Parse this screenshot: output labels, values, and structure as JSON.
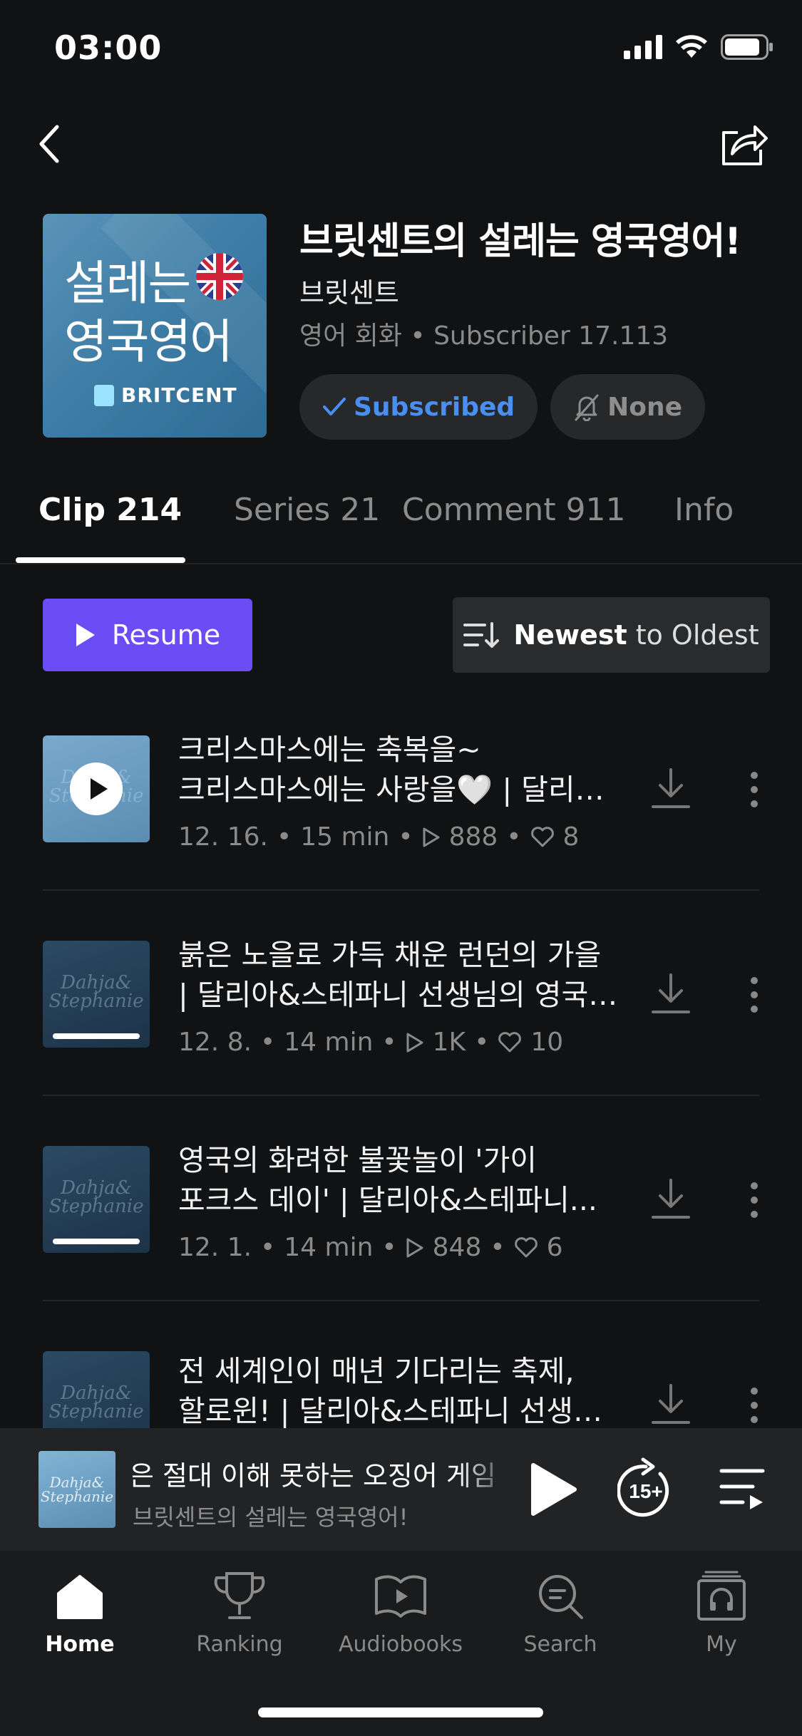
{
  "status_bar": {
    "time": "03:00"
  },
  "header": {
    "cover_line1": "설레는",
    "cover_line2": "영국영어",
    "cover_brand": "BRITCENT",
    "title": "브릿센트의 설레는 영국영어!",
    "author": "브릿센트",
    "category": "영어 회화",
    "subscribers": "Subscriber 17.113",
    "subscribed_label": "Subscribed",
    "notify_label": "None"
  },
  "tabs": [
    {
      "label": "Clip 214",
      "active": true
    },
    {
      "label": "Series 21",
      "active": false
    },
    {
      "label": "Comment 911",
      "active": false
    },
    {
      "label": "Info",
      "active": false
    }
  ],
  "actions": {
    "resume_label": "Resume",
    "sort_bold": "Newest",
    "sort_rest": " to Oldest"
  },
  "clips": [
    {
      "line1": "크리스마스에는 축복을~",
      "line2": "크리스마스에는 사랑을🤍 | 달리아&스테파니",
      "date": "12. 16.",
      "duration": "15 min",
      "plays": "888",
      "likes": "8",
      "playing": true,
      "progress": 0
    },
    {
      "line1": "붉은 노을로 가득 채운 런던의 가을",
      "line2": "| 달리아&스테파니 선생님의 영국영어",
      "date": "12. 8.",
      "duration": "14 min",
      "plays": "1K",
      "likes": "10",
      "playing": false,
      "progress": 1
    },
    {
      "line1": "영국의 화려한 불꽃놀이 '가이",
      "line2": "포크스 데이' | 달리아&스테파니...",
      "date": "12. 1.",
      "duration": "14 min",
      "plays": "848",
      "likes": "6",
      "playing": false,
      "progress": 1
    },
    {
      "line1": "전 세계인이 매년 기다리는 축제,",
      "line2": "할로윈! | 달리아&스테파니 선생님의 영국영어",
      "date": "",
      "duration": "",
      "plays": "",
      "likes": "",
      "playing": false,
      "progress": 1
    }
  ],
  "mini_player": {
    "title": "인은 절대 이해 못하는 오징어 게임",
    "subtitle": "브릿센트의 설레는 영국영어!",
    "skip_label": "15+",
    "art_caption": "Dahja& Stephanie"
  },
  "tabbar": [
    {
      "label": "Home",
      "icon": "home-icon",
      "active": true
    },
    {
      "label": "Ranking",
      "icon": "trophy-icon",
      "active": false
    },
    {
      "label": "Audiobooks",
      "icon": "book-play-icon",
      "active": false
    },
    {
      "label": "Search",
      "icon": "search-icon",
      "active": false
    },
    {
      "label": "My",
      "icon": "headphones-library-icon",
      "active": false
    }
  ],
  "colors": {
    "accent": "#6a4df4",
    "subscribed": "#4a8ff0",
    "background": "#111213"
  }
}
